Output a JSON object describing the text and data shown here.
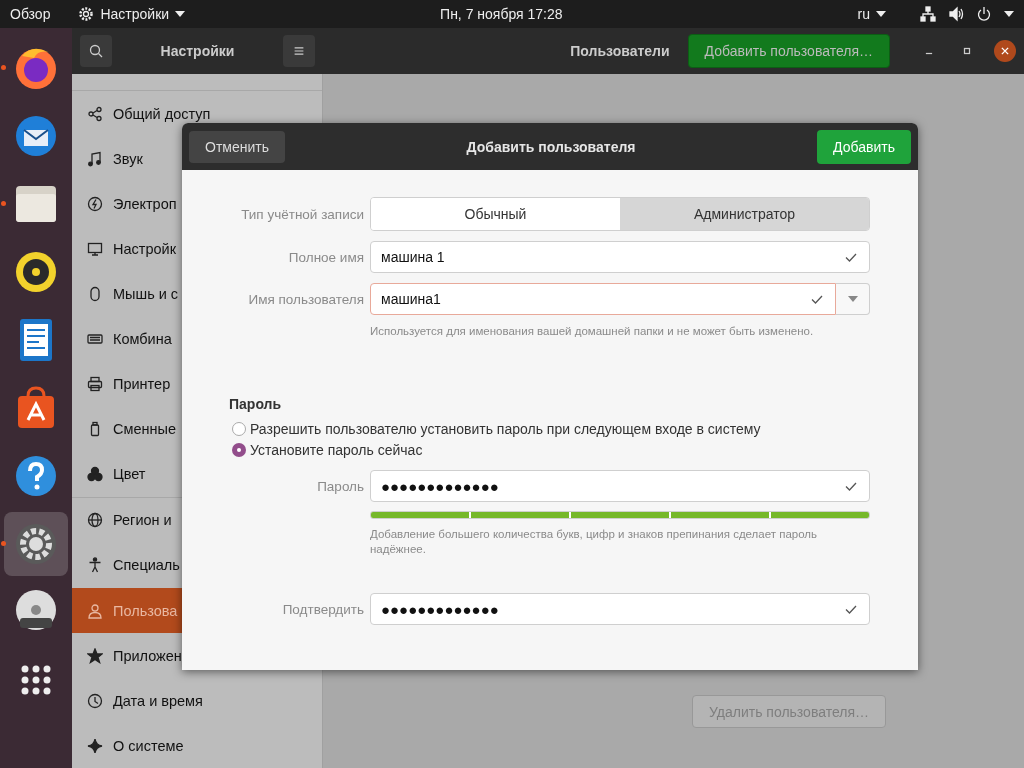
{
  "top_bar": {
    "activities": "Обзор",
    "app_menu": "Настройки",
    "clock": "Пн, 7 ноября  17:28",
    "language": "ru"
  },
  "dock": [
    {
      "kind": "browser",
      "running": true,
      "selected": false
    },
    {
      "kind": "mail",
      "running": false,
      "selected": false
    },
    {
      "kind": "files",
      "running": true,
      "selected": false
    },
    {
      "kind": "music",
      "running": false,
      "selected": false
    },
    {
      "kind": "document",
      "running": false,
      "selected": false
    },
    {
      "kind": "store",
      "running": false,
      "selected": false
    },
    {
      "kind": "help",
      "running": false,
      "selected": false
    },
    {
      "kind": "settings",
      "running": true,
      "selected": true
    },
    {
      "kind": "disc",
      "running": false,
      "selected": false
    },
    {
      "kind": "grid",
      "running": false,
      "selected": false
    }
  ],
  "window": {
    "sidebar_title": "Настройки",
    "page_title": "Пользователи",
    "add_user_button": "Добавить пользователя…"
  },
  "sidebar": {
    "items": [
      {
        "kind": "share",
        "label": "Общий доступ",
        "selected": false
      },
      {
        "kind": "music",
        "label": "Звук",
        "selected": false
      },
      {
        "kind": "power",
        "label": "Электроп",
        "selected": false
      },
      {
        "kind": "display",
        "label": "Настройк",
        "selected": false
      },
      {
        "kind": "mouse",
        "label": "Мышь и с",
        "selected": false
      },
      {
        "kind": "keyboard",
        "label": "Комбина",
        "selected": false
      },
      {
        "kind": "printer",
        "label": "Принтер",
        "selected": false
      },
      {
        "kind": "usb",
        "label": "Сменные",
        "selected": false
      },
      {
        "kind": "color",
        "label": "Цвет",
        "selected": false
      },
      {
        "kind": "globe",
        "label": "Регион и",
        "selected": false
      },
      {
        "kind": "person",
        "label": "Специаль",
        "selected": false
      },
      {
        "kind": "users",
        "label": "Пользова",
        "selected": true
      },
      {
        "kind": "star",
        "label": "Приложен",
        "selected": false
      },
      {
        "kind": "clock",
        "label": "Дата и время",
        "selected": false
      },
      {
        "kind": "sparkle",
        "label": "О системе",
        "selected": false
      }
    ]
  },
  "content": {
    "remove_user_button": "Удалить пользователя…"
  },
  "dialog": {
    "title": "Добавить пользователя",
    "cancel_button": "Отменить",
    "add_button": "Добавить",
    "account_type": {
      "label": "Тип учётной записи",
      "options": [
        {
          "label": "Обычный",
          "selected": true
        },
        {
          "label": "Администратор",
          "selected": false
        }
      ]
    },
    "full_name": {
      "label": "Полное имя",
      "value": "машина 1"
    },
    "username": {
      "label": "Имя пользователя",
      "value": "машина1",
      "hint": "Используется для именования вашей домашней папки и не может быть изменено."
    },
    "password_section": "Пароль",
    "password_options": [
      {
        "label": "Разрешить пользователю установить пароль при следующем входе в систему",
        "selected": false
      },
      {
        "label": "Установите пароль сейчас",
        "selected": true
      }
    ],
    "password": {
      "label": "Пароль",
      "value": "●●●●●●●●●●●●●",
      "strength": {
        "level": 1
      },
      "hint": "Добавление большего количества букв, цифр и знаков препинания сделает пароль надёжнее."
    },
    "confirm": {
      "label": "Подтвердить",
      "value": "●●●●●●●●●●●●●"
    }
  }
}
